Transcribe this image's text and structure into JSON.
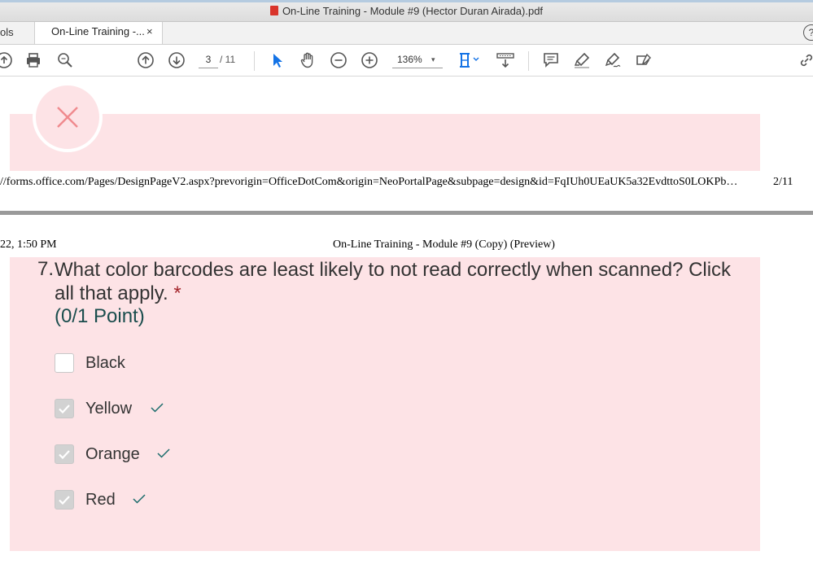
{
  "window": {
    "title": "On-Line Training - Module #9 (Hector Duran Airada).pdf"
  },
  "tabs": {
    "tools_label": "ols",
    "document_tab_label": "On-Line Training -...",
    "close_glyph": "×",
    "help_glyph": "?"
  },
  "toolbar": {
    "current_page": "3",
    "page_total": "/ 11",
    "zoom": "136%",
    "zoom_caret": "▾",
    "icons": [
      "upload-icon",
      "print-icon",
      "search-zoom-icon",
      "prev-page-icon",
      "next-page-icon",
      "select-arrow-icon",
      "hand-icon",
      "zoom-out-icon",
      "zoom-in-icon",
      "fit-page-icon",
      "scroll-mode-icon",
      "comment-icon",
      "highlight-icon",
      "sign-icon",
      "fill-sign-icon",
      "link-icon"
    ]
  },
  "page_footer": {
    "url": "//forms.office.com/Pages/DesignPageV2.aspx?prevorigin=OfficeDotCom&origin=NeoPortalPage&subpage=design&id=FqIUh0UEaUK5a32EvdttoS0LOKPb…",
    "page_num": "2/11"
  },
  "page_header": {
    "date": "22, 1:50 PM",
    "title": "On-Line Training - Module #9 (Copy) (Preview)"
  },
  "question": {
    "number": "7.",
    "text": "What color barcodes are least likely to not read correctly when scanned?  Click all that apply.",
    "required_mark": "*",
    "points": "(0/1 Point)",
    "options": [
      {
        "label": "Black",
        "checked": false,
        "correct": false
      },
      {
        "label": "Yellow",
        "checked": true,
        "correct": true
      },
      {
        "label": "Orange",
        "checked": true,
        "correct": true
      },
      {
        "label": "Red",
        "checked": true,
        "correct": true
      }
    ]
  },
  "colors": {
    "card_bg": "#fde3e6",
    "tick": "#1a6b6b",
    "required": "#a4262c",
    "accent_blue": "#1473e6"
  }
}
